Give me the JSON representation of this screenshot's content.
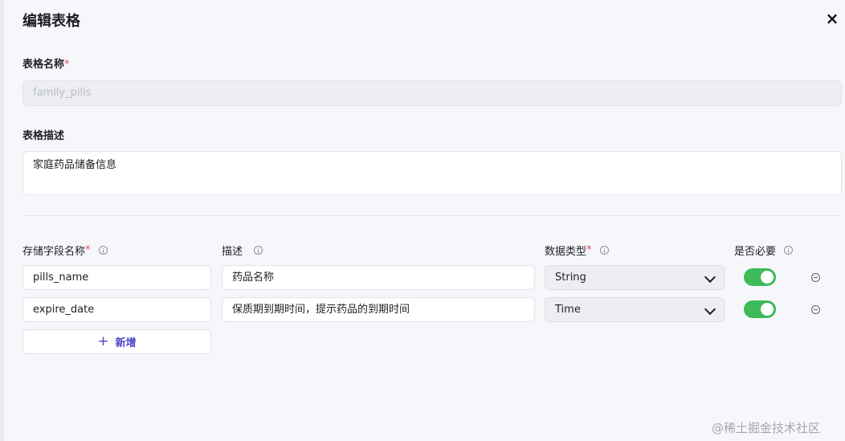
{
  "dialog": {
    "title": "编辑表格",
    "close_icon": "×"
  },
  "form": {
    "table_name": {
      "label": "表格名称",
      "required_mark": "*",
      "value": "family_pills"
    },
    "table_description": {
      "label": "表格描述",
      "value": "家庭药品储备信息"
    }
  },
  "fields_table": {
    "headers": {
      "field_name": {
        "label": "存储字段名称",
        "required_mark": "*"
      },
      "description": {
        "label": "描述"
      },
      "data_type": {
        "label": "数据类型",
        "required_mark": "*"
      },
      "required": {
        "label": "是否必要"
      }
    },
    "rows": [
      {
        "field_name": "pills_name",
        "description": "药品名称",
        "data_type": "String",
        "required": true
      },
      {
        "field_name": "expire_date",
        "description": "保质期到期时间，提示药品的到期时间",
        "data_type": "Time",
        "required": true
      }
    ],
    "add_button": {
      "icon": "+",
      "label": "新增"
    }
  },
  "watermark": "@稀土掘金技术社区",
  "colors": {
    "accent": "#4f46c8",
    "toggle_on": "#3dba5a",
    "required": "#e34d59"
  }
}
